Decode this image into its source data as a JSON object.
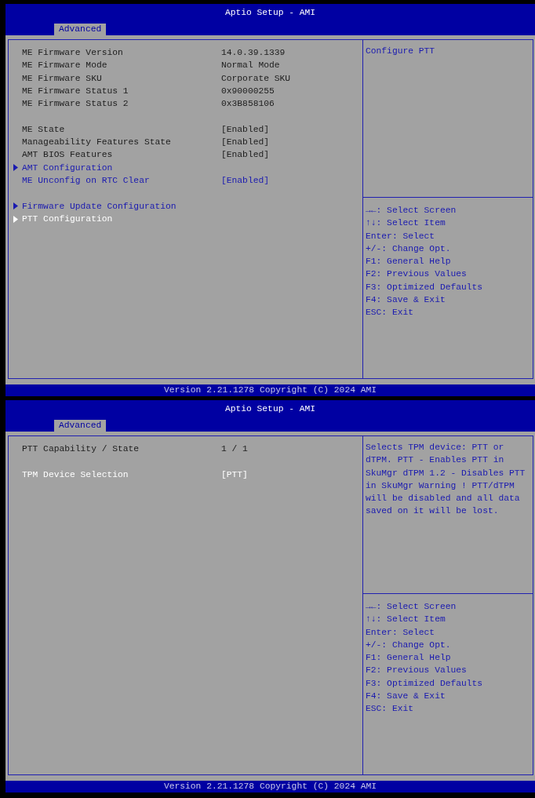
{
  "screens": [
    {
      "title": "Aptio Setup - AMI",
      "tabs": [
        {
          "label": "Advanced",
          "selected": true
        }
      ],
      "groups": [
        {
          "items": [
            {
              "kind": "info",
              "label": "ME Firmware Version",
              "value": "14.0.39.1339",
              "selected": false
            },
            {
              "kind": "info",
              "label": "ME Firmware Mode",
              "value": "Normal Mode",
              "selected": false
            },
            {
              "kind": "info",
              "label": "ME Firmware SKU",
              "value": "Corporate SKU",
              "selected": false
            },
            {
              "kind": "info",
              "label": "ME Firmware Status 1",
              "value": "0x90000255",
              "selected": false
            },
            {
              "kind": "info",
              "label": "ME Firmware Status 2",
              "value": "0x3B858106",
              "selected": false
            }
          ]
        },
        {
          "items": [
            {
              "kind": "info",
              "label": "ME State",
              "value": "[Enabled]",
              "selected": false
            },
            {
              "kind": "info",
              "label": "Manageability Features State",
              "value": "[Enabled]",
              "selected": false
            },
            {
              "kind": "info",
              "label": "AMT BIOS Features",
              "value": "[Enabled]",
              "selected": false
            },
            {
              "kind": "submenu",
              "label": "AMT Configuration",
              "selected": false
            },
            {
              "kind": "option",
              "label": "ME Unconfig on RTC Clear",
              "value": "[Enabled]",
              "selected": false
            }
          ]
        },
        {
          "items": [
            {
              "kind": "submenu",
              "label": "Firmware Update Configuration",
              "selected": false
            },
            {
              "kind": "submenu",
              "label": "PTT Configuration",
              "selected": true
            }
          ]
        }
      ],
      "help": "Configure PTT",
      "keys": [
        "→←: Select Screen",
        "↑↓: Select Item",
        "Enter: Select",
        "+/-: Change Opt.",
        "F1: General Help",
        "F2: Previous Values",
        "F3: Optimized Defaults",
        "F4: Save & Exit",
        "ESC: Exit"
      ],
      "footer": "Version 2.21.1278 Copyright (C) 2024 AMI"
    },
    {
      "title": "Aptio Setup - AMI",
      "tabs": [
        {
          "label": "Advanced",
          "selected": true
        }
      ],
      "groups": [
        {
          "items": [
            {
              "kind": "info",
              "label": "PTT Capability / State",
              "value": "1 / 1",
              "selected": false
            }
          ]
        },
        {
          "items": [
            {
              "kind": "option",
              "label": "TPM Device Selection",
              "value": "[PTT]",
              "selected": true
            }
          ]
        }
      ],
      "help": "Selects TPM device: PTT or dTPM. PTT - Enables PTT in SkuMgr dTPM 1.2 - Disables PTT in SkuMgr Warning ! PTT/dTPM will be disabled and all data saved on it will be lost.",
      "keys": [
        "→←: Select Screen",
        "↑↓: Select Item",
        "Enter: Select",
        "+/-: Change Opt.",
        "F1: General Help",
        "F2: Previous Values",
        "F3: Optimized Defaults",
        "F4: Save & Exit",
        "ESC: Exit"
      ],
      "footer": "Version 2.21.1278 Copyright (C) 2024 AMI"
    }
  ]
}
